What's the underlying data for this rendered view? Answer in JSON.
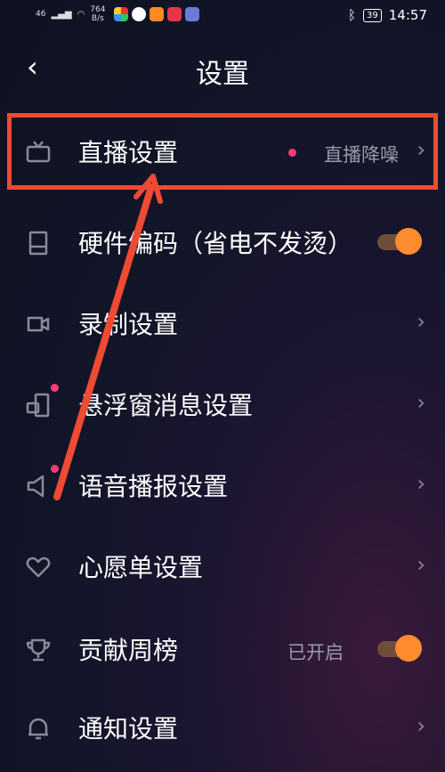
{
  "status_bar": {
    "signal": "46",
    "speed_value": "764",
    "speed_unit": "B/s",
    "battery": "39",
    "time": "14:57"
  },
  "header": {
    "back_symbol": "‹",
    "title": "设置"
  },
  "settings": {
    "live": {
      "label": "直播设置",
      "value": "直播降噪"
    },
    "hardware": {
      "label": "硬件编码（省电不发烫）"
    },
    "record": {
      "label": "录制设置"
    },
    "floating": {
      "label": "悬浮窗消息设置"
    },
    "voice": {
      "label": "语音播报设置"
    },
    "wishlist": {
      "label": "心愿单设置"
    },
    "contrib": {
      "label": "贡献周榜",
      "value": "已开启"
    },
    "notify": {
      "label": "通知设置"
    }
  },
  "icons": {
    "tv": "tv-icon",
    "hardware": "hardware-icon",
    "camera": "camera-icon",
    "floating": "floating-window-icon",
    "speaker": "speaker-icon",
    "heart": "heart-icon",
    "trophy": "trophy-icon",
    "bell": "bell-icon"
  },
  "colors": {
    "accent_orange": "#ff8c2e",
    "dot_pink": "#ff3b77",
    "annotation_red": "#ef4a33"
  }
}
